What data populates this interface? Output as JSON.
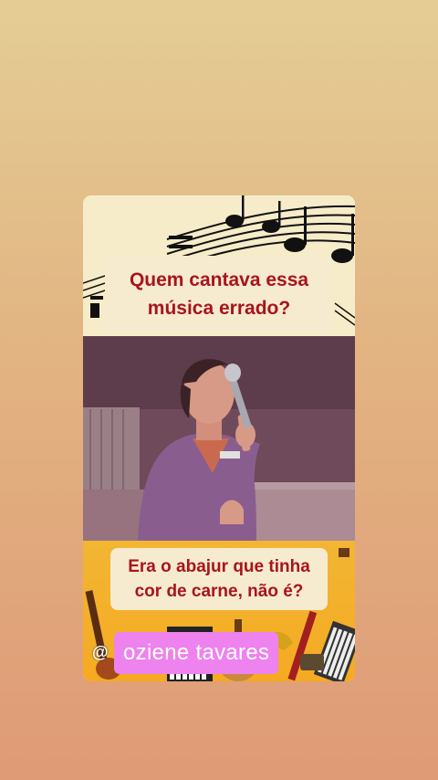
{
  "question": "Quem cantava essa música errado?",
  "answer": "Era o abajur que tinha cor de carne, não é?",
  "watermark": "@",
  "username": "oziene tavares",
  "colors": {
    "accent_text": "#a8141d",
    "name_tag": "#ee82ee",
    "panel": "#f6ebcf",
    "bottom_bg": "#f5aa22"
  }
}
